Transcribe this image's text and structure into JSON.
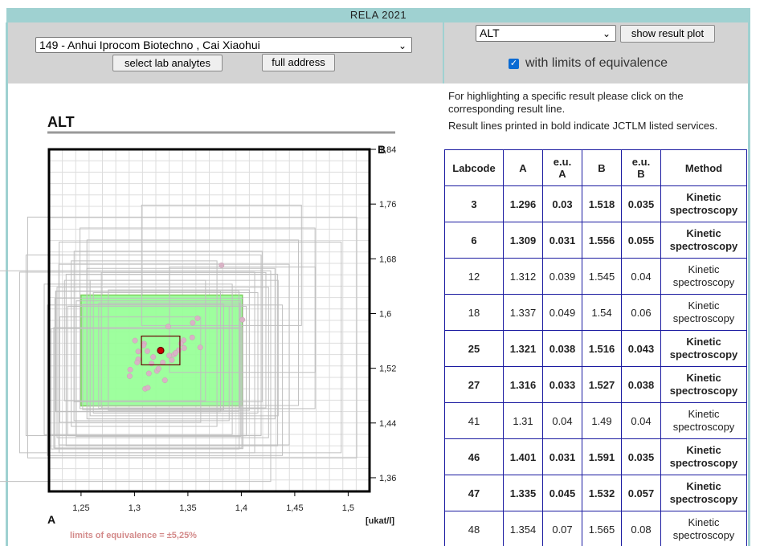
{
  "header": {
    "title": "RELA 2021"
  },
  "lab_select": {
    "value": "149 - Anhui Iprocom Biotechno , Cai Xiaohui"
  },
  "buttons": {
    "select_analytes": "select lab analytes",
    "full_address": "full address",
    "show_plot": "show result plot"
  },
  "analyte_select": {
    "value": "ALT"
  },
  "equivalence_checkbox": {
    "checked": true,
    "label": "with limits of equivalence"
  },
  "info": {
    "line1": "For highlighting a specific result please click on the corresponding result line.",
    "line2": "Result lines printed in bold indicate JCTLM listed services."
  },
  "table": {
    "headers": [
      "Labcode",
      "A",
      "e.u.\nA",
      "B",
      "e.u.\nB",
      "Method"
    ],
    "rows": [
      {
        "labcode": "3",
        "a": "1.296",
        "eua": "0.03",
        "b": "1.518",
        "eub": "0.035",
        "method": "Kinetic spectroscopy",
        "bold": true
      },
      {
        "labcode": "6",
        "a": "1.309",
        "eua": "0.031",
        "b": "1.556",
        "eub": "0.055",
        "method": "Kinetic spectroscopy",
        "bold": true
      },
      {
        "labcode": "12",
        "a": "1.312",
        "eua": "0.039",
        "b": "1.545",
        "eub": "0.04",
        "method": "Kinetic spectroscopy",
        "bold": false
      },
      {
        "labcode": "18",
        "a": "1.337",
        "eua": "0.049",
        "b": "1.54",
        "eub": "0.06",
        "method": "Kinetic spectroscopy",
        "bold": false
      },
      {
        "labcode": "25",
        "a": "1.321",
        "eua": "0.038",
        "b": "1.516",
        "eub": "0.043",
        "method": "Kinetic spectroscopy",
        "bold": true
      },
      {
        "labcode": "27",
        "a": "1.316",
        "eua": "0.033",
        "b": "1.527",
        "eub": "0.038",
        "method": "Kinetic spectroscopy",
        "bold": true
      },
      {
        "labcode": "41",
        "a": "1.31",
        "eua": "0.04",
        "b": "1.49",
        "eub": "0.04",
        "method": "Kinetic spectroscopy",
        "bold": false
      },
      {
        "labcode": "46",
        "a": "1.401",
        "eua": "0.031",
        "b": "1.591",
        "eub": "0.035",
        "method": "Kinetic spectroscopy",
        "bold": true
      },
      {
        "labcode": "47",
        "a": "1.335",
        "eua": "0.045",
        "b": "1.532",
        "eub": "0.057",
        "method": "Kinetic spectroscopy",
        "bold": true
      },
      {
        "labcode": "48",
        "a": "1.354",
        "eua": "0.07",
        "b": "1.565",
        "eub": "0.08",
        "method": "Kinetic spectroscopy",
        "bold": false
      }
    ]
  },
  "colors": {
    "accent_bar": "#9fd1d1",
    "panel": "#d3d3d3",
    "table_border": "#1a1aa0",
    "equiv_fill": "#99ff99",
    "highlight": "#990000"
  },
  "chart_data": {
    "type": "scatter",
    "title": "ALT",
    "xlabel": "A",
    "ylabel": "",
    "unit_label": "[ukat/l]",
    "xlim": [
      1.22,
      1.52
    ],
    "ylim": [
      1.34,
      1.84
    ],
    "x_ticks": [
      "1,25",
      "1,3",
      "1,35",
      "1,4",
      "1,45",
      "1,5"
    ],
    "x_tick_values": [
      1.25,
      1.3,
      1.35,
      1.4,
      1.45,
      1.5
    ],
    "y_ticks": [
      "1,84",
      "1,76",
      "1,68",
      "1,6",
      "1,52",
      "1,44",
      "1,36"
    ],
    "y_tick_values": [
      1.84,
      1.76,
      1.68,
      1.6,
      1.52,
      1.44,
      1.36
    ],
    "y_top_overlap_label": "B",
    "equivalence_note": "limits of equivalence = ±5,25%",
    "highlight": {
      "x": 1.3245,
      "y": 1.546,
      "eu_x": 0.018,
      "eu_y": 0.021
    },
    "equivalence_box": {
      "x": [
        1.25,
        1.401
      ],
      "y": [
        1.465,
        1.627
      ]
    },
    "points": [
      {
        "x": 1.296,
        "y": 1.518,
        "eux": 0.03,
        "euy": 0.035
      },
      {
        "x": 1.309,
        "y": 1.556,
        "eux": 0.031,
        "euy": 0.055
      },
      {
        "x": 1.312,
        "y": 1.545,
        "eux": 0.039,
        "euy": 0.04
      },
      {
        "x": 1.337,
        "y": 1.54,
        "eux": 0.049,
        "euy": 0.06
      },
      {
        "x": 1.321,
        "y": 1.516,
        "eux": 0.038,
        "euy": 0.043
      },
      {
        "x": 1.316,
        "y": 1.527,
        "eux": 0.033,
        "euy": 0.038
      },
      {
        "x": 1.31,
        "y": 1.49,
        "eux": 0.04,
        "euy": 0.04
      },
      {
        "x": 1.401,
        "y": 1.591,
        "eux": 0.031,
        "euy": 0.035
      },
      {
        "x": 1.335,
        "y": 1.532,
        "eux": 0.045,
        "euy": 0.057
      },
      {
        "x": 1.354,
        "y": 1.565,
        "eux": 0.07,
        "euy": 0.08
      },
      {
        "x": 1.3815,
        "y": 1.6705,
        "eux": 0.034,
        "euy": 0.04
      },
      {
        "x": 1.3315,
        "y": 1.581,
        "eux": 0.04,
        "euy": 0.05
      },
      {
        "x": 1.359,
        "y": 1.593,
        "eux": 0.05,
        "euy": 0.06
      },
      {
        "x": 1.346,
        "y": 1.561,
        "eux": 0.035,
        "euy": 0.045
      },
      {
        "x": 1.3415,
        "y": 1.5465,
        "eux": 0.03,
        "euy": 0.04
      },
      {
        "x": 1.3035,
        "y": 1.533,
        "eux": 0.04,
        "euy": 0.05
      },
      {
        "x": 1.2955,
        "y": 1.5085,
        "eux": 0.06,
        "euy": 0.07
      },
      {
        "x": 1.3285,
        "y": 1.5025,
        "eux": 0.05,
        "euy": 0.05
      },
      {
        "x": 1.3035,
        "y": 1.5445,
        "eux": 0.035,
        "euy": 0.04
      },
      {
        "x": 1.3435,
        "y": 1.556,
        "eux": 0.04,
        "euy": 0.05
      },
      {
        "x": 1.3545,
        "y": 1.5865,
        "eux": 0.045,
        "euy": 0.055
      },
      {
        "x": 1.3325,
        "y": 1.5385,
        "eux": 0.03,
        "euy": 0.035
      },
      {
        "x": 1.3225,
        "y": 1.5195,
        "eux": 0.035,
        "euy": 0.045
      },
      {
        "x": 1.3135,
        "y": 1.5125,
        "eux": 0.04,
        "euy": 0.05
      },
      {
        "x": 1.3085,
        "y": 1.5535,
        "eux": 0.05,
        "euy": 0.06
      },
      {
        "x": 1.3175,
        "y": 1.5365,
        "eux": 0.03,
        "euy": 0.035
      },
      {
        "x": 1.3385,
        "y": 1.5425,
        "eux": 0.035,
        "euy": 0.04
      },
      {
        "x": 1.3465,
        "y": 1.5495,
        "eux": 0.04,
        "euy": 0.045
      },
      {
        "x": 1.3025,
        "y": 1.5285,
        "eux": 0.05,
        "euy": 0.06
      },
      {
        "x": 1.3265,
        "y": 1.5285,
        "eux": 0.045,
        "euy": 0.05
      },
      {
        "x": 1.3125,
        "y": 1.4915,
        "eux": 0.04,
        "euy": 0.04
      },
      {
        "x": 1.3005,
        "y": 1.5605,
        "eux": 0.03,
        "euy": 0.04
      },
      {
        "x": 1.3615,
        "y": 1.5505,
        "eux": 0.06,
        "euy": 0.07
      }
    ]
  }
}
